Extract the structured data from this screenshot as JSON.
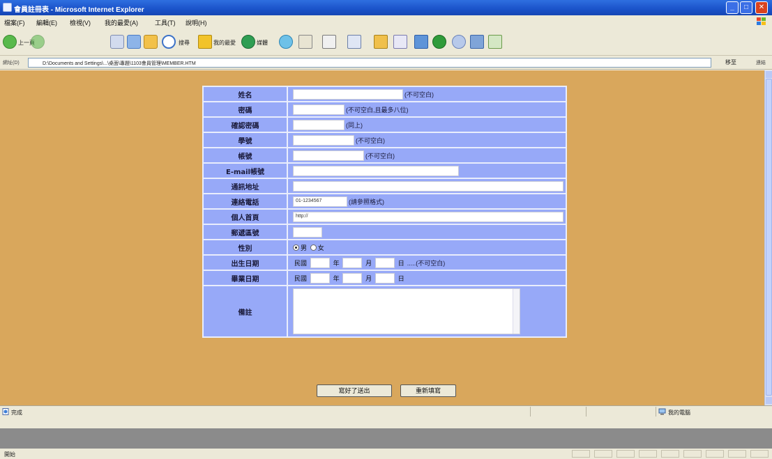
{
  "window": {
    "title": "會員註冊表 - Microsoft Internet Explorer",
    "buttons": {
      "minimize": "_",
      "maximize": "□",
      "close": "✕"
    }
  },
  "menu": [
    "檔案(F)",
    "編輯(E)",
    "檢視(V)",
    "我的最愛(A)",
    "工具(T)",
    "說明(H)"
  ],
  "toolbar": {
    "back": "上一頁",
    "search": "搜尋",
    "favorites": "我的最愛",
    "media": "媒體"
  },
  "address": {
    "label": "網址(D)",
    "url": "D:\\Documents and Settings\\...\\桌面\\專題\\1103會員管理\\MEMBER.HTM",
    "go": "移至",
    "links": "連結"
  },
  "form": {
    "rows": [
      {
        "label": "姓名",
        "note": "(不可空白)"
      },
      {
        "label": "密碼",
        "note": "(不可空白,且最多八位)"
      },
      {
        "label": "確認密碼",
        "note": "(同上)"
      },
      {
        "label": "學號",
        "note": "(不可空白)"
      },
      {
        "label": "帳號",
        "note": "(不可空白)"
      },
      {
        "label": "E-mail帳號",
        "note": ""
      },
      {
        "label": "通訊地址",
        "note": ""
      },
      {
        "label": "連絡電話",
        "value": "01-1234567",
        "note": "(請參照格式)"
      },
      {
        "label": "個人首頁",
        "value": "http://"
      },
      {
        "label": "郵遞區號"
      },
      {
        "label": "性別",
        "options": [
          "男",
          "女"
        ],
        "selected": "男"
      },
      {
        "label": "出生日期",
        "prefix": "民國",
        "year": "年",
        "month": "月",
        "day": "日",
        "note": ".....(不可空白)"
      },
      {
        "label": "畢業日期",
        "prefix": "民國",
        "year": "年",
        "month": "月",
        "day": "日"
      },
      {
        "label": "備註"
      }
    ],
    "submit": "寫好了送出",
    "reset": "重新填寫"
  },
  "status": {
    "done": "完成",
    "zone": "我的電腦"
  },
  "taskbar": {
    "label": "開始"
  }
}
